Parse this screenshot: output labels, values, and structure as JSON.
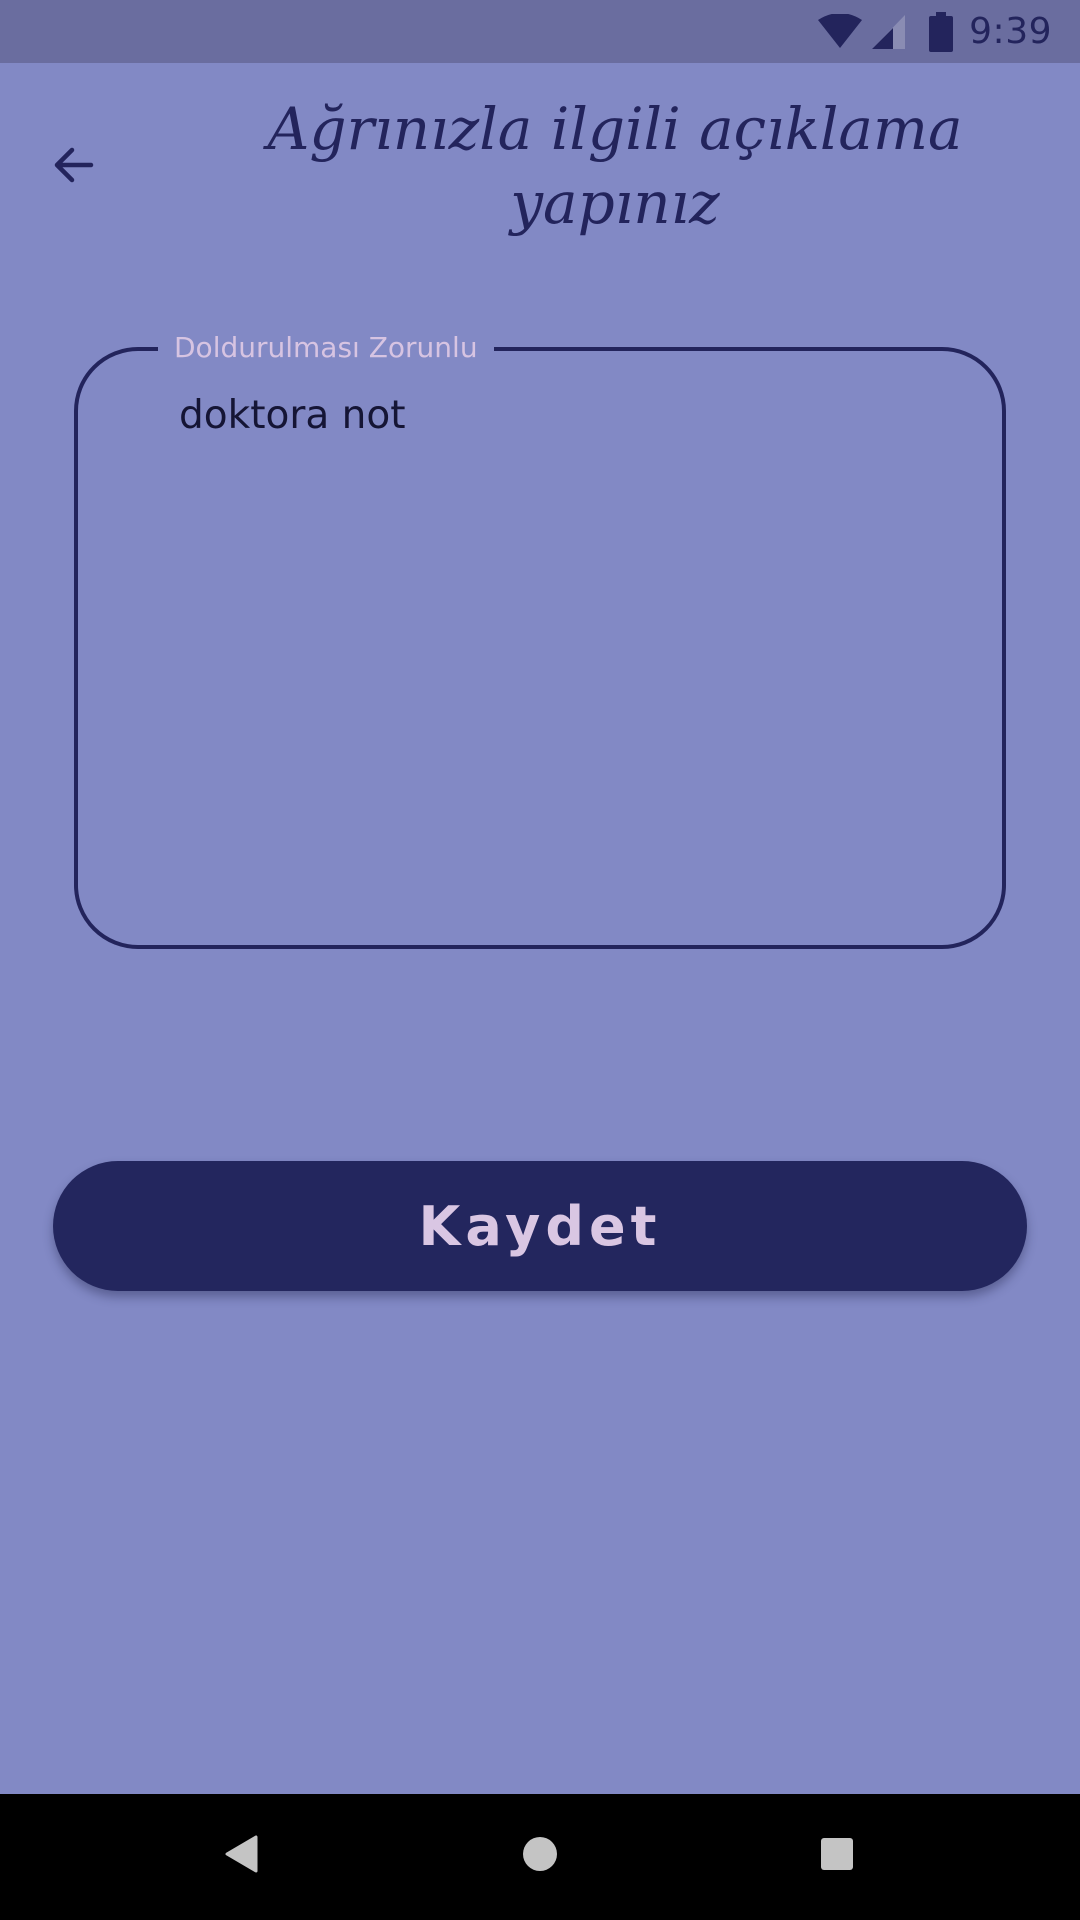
{
  "status_bar": {
    "time": "9:39",
    "icons": [
      "wifi-icon",
      "cellular-signal-icon",
      "battery-icon"
    ]
  },
  "header": {
    "back_icon": "arrow-back-icon",
    "title": "Ağrınızla ilgili açıklama yapınız"
  },
  "note_field": {
    "label": "Doldurulması Zorunlu",
    "value": "doktora not"
  },
  "save_button": {
    "label": "Kaydet"
  },
  "nav_bar": {
    "icons": [
      "nav-back-icon",
      "nav-home-icon",
      "nav-recents-icon"
    ]
  },
  "colors": {
    "background": "#8289C5",
    "status_bar": "#6A6D9F",
    "primary_dark": "#23265E",
    "label_light": "#D9C6E3",
    "nav_bar": "#000000"
  }
}
